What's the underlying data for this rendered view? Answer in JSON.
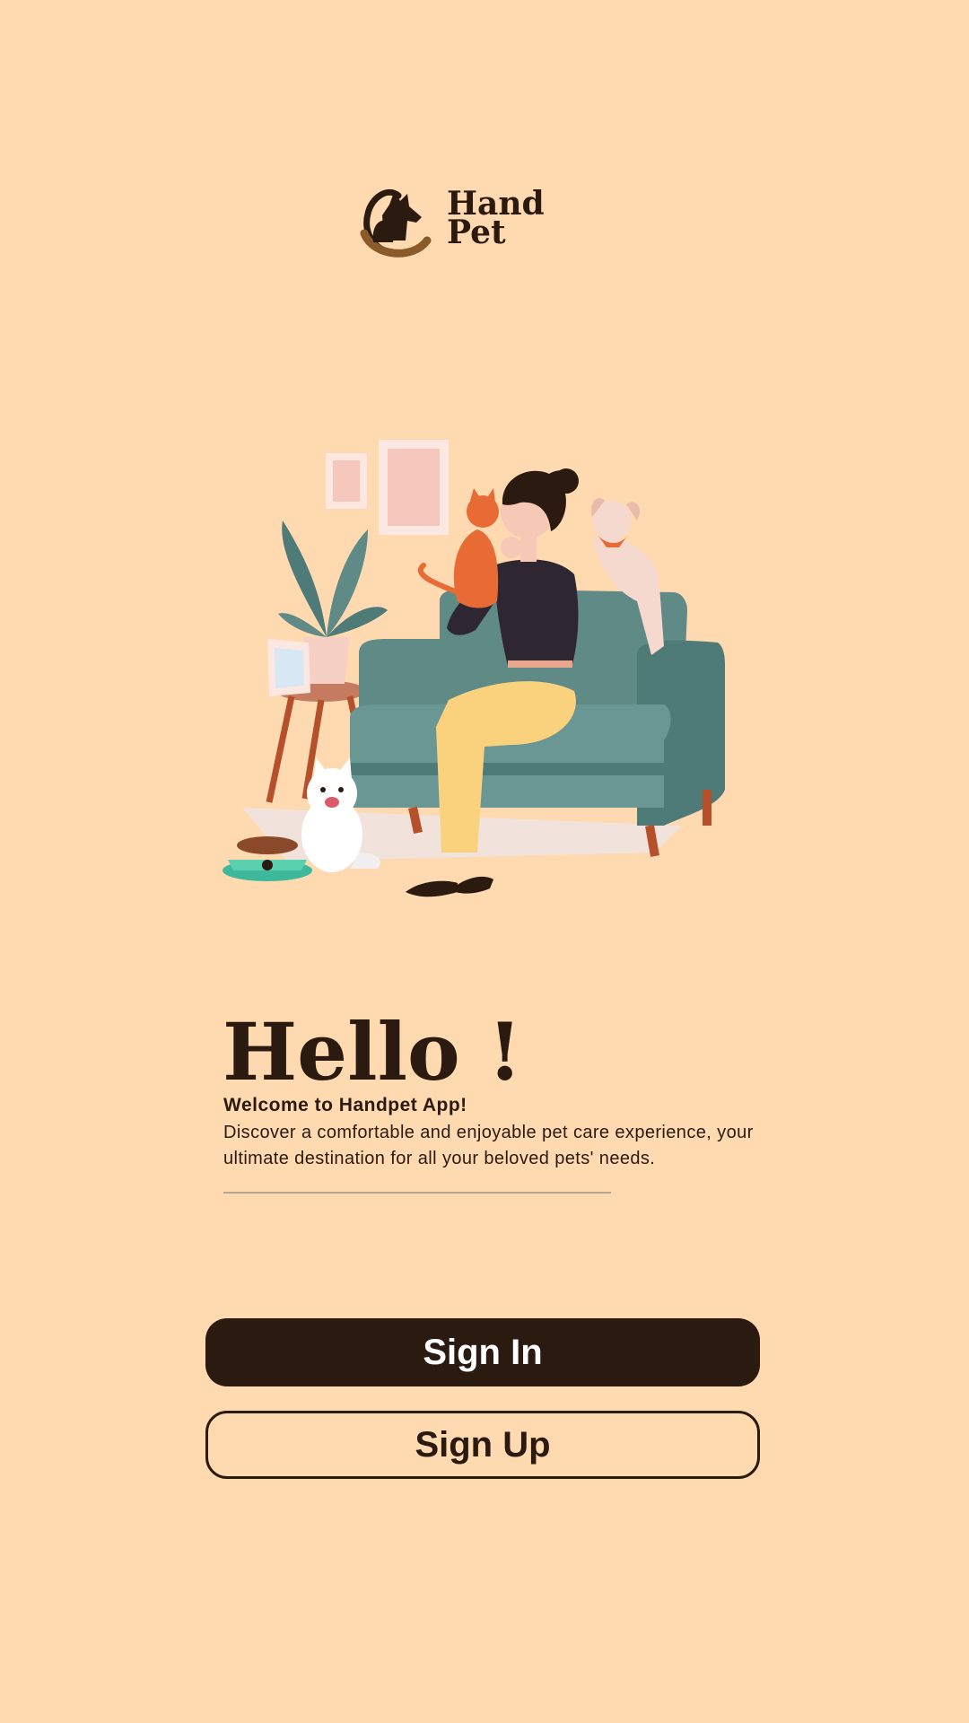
{
  "brand": {
    "logo_line1": "Hand",
    "logo_line2": "Pet",
    "logo_icon": "dog-cat-heart-icon"
  },
  "hero": {
    "illustration": "woman-on-sofa-with-pets-illustration"
  },
  "intro": {
    "title": "Hello !",
    "subtitle": "Welcome to Handpet App!",
    "description": "Discover a comfortable and enjoyable pet care experience, your ultimate destination for all your beloved pets' needs."
  },
  "actions": {
    "sign_in_label": "Sign In",
    "sign_up_label": "Sign Up"
  },
  "colors": {
    "background": "#FFD9B0",
    "primary": "#2A1A10",
    "sofa": "#5F8A86",
    "accent": "#E86A34"
  }
}
